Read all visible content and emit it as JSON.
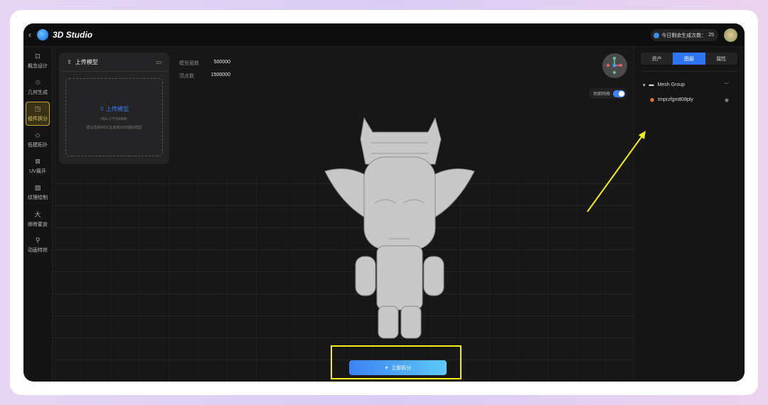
{
  "header": {
    "back": "‹",
    "title": "3D Studio",
    "quota_label": "今日剩余生成次数：",
    "quota_value": "25"
  },
  "sidebar": {
    "items": [
      {
        "label": "概念设计",
        "icon": "concept-icon",
        "glyph": "⊡"
      },
      {
        "label": "几何生成",
        "icon": "geometry-icon",
        "glyph": "♲"
      },
      {
        "label": "组件拆分",
        "icon": "split-icon",
        "glyph": "◳",
        "active": true
      },
      {
        "label": "低模拓扑",
        "icon": "topology-icon",
        "glyph": "◇"
      },
      {
        "label": "UV展开",
        "icon": "uv-icon",
        "glyph": "⊠"
      },
      {
        "label": "纹理绘制",
        "icon": "texture-icon",
        "glyph": "▧"
      },
      {
        "label": "绑骨蒙皮",
        "icon": "rig-icon",
        "glyph": "大"
      },
      {
        "label": "动画特效",
        "icon": "animation-icon",
        "glyph": "⚲"
      }
    ]
  },
  "upload": {
    "title": "上传模型",
    "button": "上传模型",
    "hint1": "FBX,小于500MB,",
    "hint2": "建议选择AIGC生成或3D扫描的模型"
  },
  "stats": [
    {
      "label": "模型面数",
      "value": "500000"
    },
    {
      "label": "顶点数",
      "value": "1500000"
    }
  ],
  "viewport": {
    "ground_grid_label": "地面网格",
    "ground_grid_on": true,
    "action_button": "立即拆分"
  },
  "panel": {
    "tabs": [
      "资产",
      "图层",
      "属性"
    ],
    "active_tab": "图层",
    "group": "Mesh Group",
    "mesh": "tmprzfgm808ply"
  },
  "colors": {
    "accent": "#2f74f5",
    "highlight": "#f4ef1c",
    "active_side": "#c9a431"
  }
}
